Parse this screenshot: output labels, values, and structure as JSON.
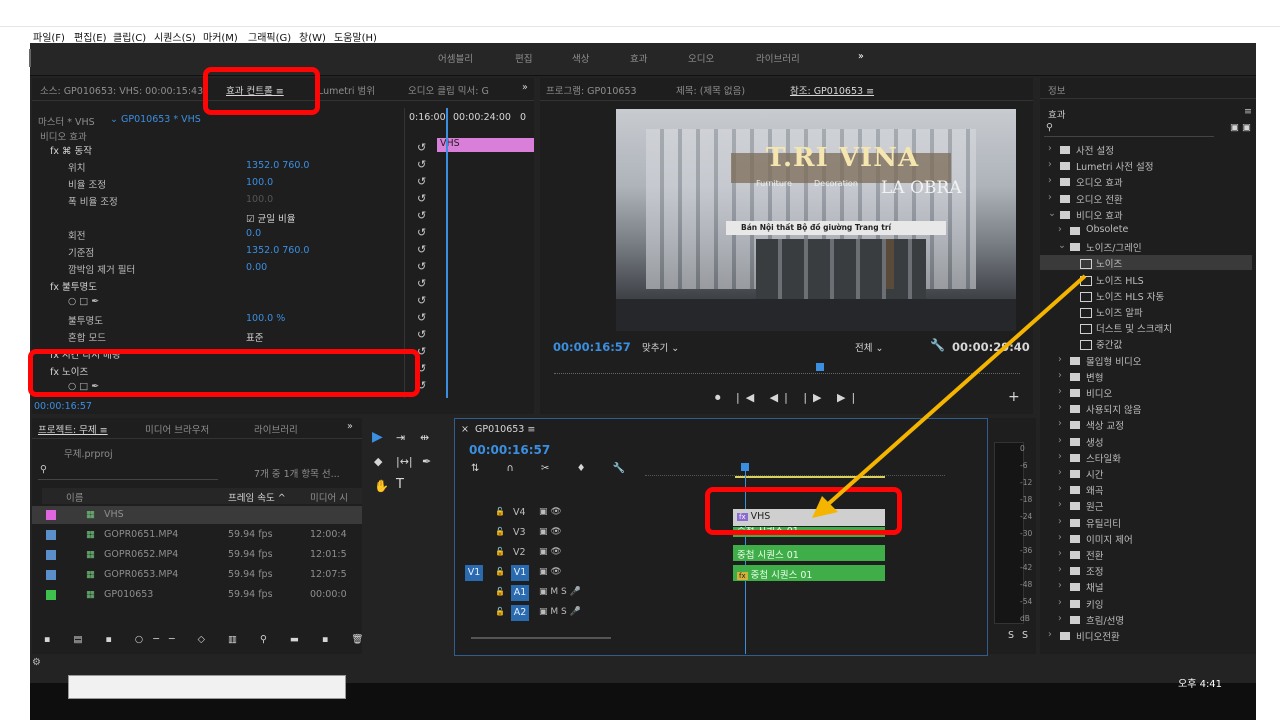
{
  "menubar": [
    "파일(F)",
    "편집(E)",
    "클립(C)",
    "시퀀스(S)",
    "마커(M)",
    "그래픽(G)",
    "창(W)",
    "도움말(H)"
  ],
  "workspaces": [
    "어셈블리",
    "편집",
    "색상",
    "효과",
    "오디오",
    "라이브러리",
    "»"
  ],
  "source_panel": {
    "tabs": [
      "소스: GP010653: VHS: 00:00:15:43",
      "효과 컨트롤 ≡",
      "Lumetri 범위",
      "오디오 클립 믹서: G",
      "»"
    ],
    "master": "마스터 * VHS",
    "clip": "GP010653 * VHS",
    "ruler_times": [
      "0:16:00",
      "00:00:24:00",
      "0"
    ],
    "vhs_label": "VHS",
    "section": "비디오 효과",
    "rows": [
      {
        "label": "fx ⌘ 동작",
        "indent": 0
      },
      {
        "label": "위치",
        "value": "1352.0   760.0",
        "indent": 1
      },
      {
        "label": "비율 조정",
        "value": "100.0",
        "indent": 1
      },
      {
        "label": "폭 비율 조정",
        "value": "100.0",
        "indent": 1
      },
      {
        "label": "",
        "value": "☑ 균일 비율",
        "indent": 1
      },
      {
        "label": "회전",
        "value": "0.0",
        "indent": 1
      },
      {
        "label": "기준점",
        "value": "1352.0   760.0",
        "indent": 1
      },
      {
        "label": "깜박임 제거 필터",
        "value": "0.00",
        "indent": 1
      },
      {
        "label": "fx 불투명도",
        "indent": 0
      },
      {
        "label": "○ □ ✒",
        "indent": 1
      },
      {
        "label": "불투명도",
        "value": "100.0 %",
        "indent": 1
      },
      {
        "label": "혼합 모드",
        "value": "표준",
        "indent": 1
      },
      {
        "label": "fx 시간 다시 매핑",
        "indent": 0
      },
      {
        "label": "fx 노이즈",
        "indent": 0
      },
      {
        "label": "○ □ ✒",
        "indent": 1
      }
    ],
    "timecode": "00:00:16:57"
  },
  "program": {
    "tabs": [
      "프로그램: GP010653",
      "제목: (제목 없음)",
      "참조: GP010653 ≡"
    ],
    "timecode": "00:00:16:57",
    "fit": "맞추기",
    "full": "전체",
    "end_time": "00:00:29:40",
    "signage": [
      "T.RI VINA",
      "LA OBRA",
      "Furniture",
      "Decoration",
      "Bán Nội thất  Bộ đồ giường  Trang trí"
    ]
  },
  "project": {
    "tabs": [
      "프로젝트: 무제 ≡",
      "미디어 브라우저",
      "라이브러리",
      "»"
    ],
    "file": "무제.prproj",
    "count": "7개 중 1개 항목 선...",
    "headers": [
      "이름",
      "프레임 속도 ^",
      "미디어 시"
    ],
    "items": [
      {
        "name": "VHS",
        "fps": "",
        "time": "",
        "color": "#e066e0"
      },
      {
        "name": "GOPR0651.MP4",
        "fps": "59.94 fps",
        "time": "12:00:4",
        "color": "#5b8fc9"
      },
      {
        "name": "GOPR0652.MP4",
        "fps": "59.94 fps",
        "time": "12:01:5",
        "color": "#5b8fc9"
      },
      {
        "name": "GOPR0653.MP4",
        "fps": "59.94 fps",
        "time": "12:07:5",
        "color": "#5b8fc9"
      },
      {
        "name": "GP010653",
        "fps": "59.94 fps",
        "time": "00:00:0",
        "color": "#3fbf4f"
      }
    ]
  },
  "timeline": {
    "tab": "GP010653 ≡",
    "timecode": "00:00:16:57",
    "video_tracks": [
      "V4",
      "V3",
      "V2",
      "V1"
    ],
    "audio_tracks": [
      "A1",
      "A2"
    ],
    "v1_source": "V1",
    "clips": {
      "v4": "VHS",
      "v3": "중첩 시퀀스 01",
      "v2": "중첩 시퀀스 01",
      "v1": "중첩 시퀀스 01"
    }
  },
  "meter": {
    "scale": [
      "0",
      "-6",
      "-12",
      "-18",
      "-24",
      "-30",
      "-36",
      "-42",
      "-48",
      "-54",
      "dB"
    ],
    "solo": [
      "S",
      "S"
    ]
  },
  "effects": {
    "info": "정보",
    "title": "효과",
    "tree": [
      {
        "label": "사전 설정",
        "level": 0,
        "type": "folder"
      },
      {
        "label": "Lumetri 사전 설정",
        "level": 0,
        "type": "folder"
      },
      {
        "label": "오디오 효과",
        "level": 0,
        "type": "folder"
      },
      {
        "label": "오디오 전환",
        "level": 0,
        "type": "folder"
      },
      {
        "label": "비디오 효과",
        "level": 0,
        "type": "folder"
      },
      {
        "label": "Obsolete",
        "level": 1,
        "type": "folder"
      },
      {
        "label": "노이즈/그레인",
        "level": 1,
        "type": "folder"
      },
      {
        "label": "노이즈",
        "level": 2,
        "type": "effect",
        "selected": true
      },
      {
        "label": "노이즈 HLS",
        "level": 2,
        "type": "effect"
      },
      {
        "label": "노이즈 HLS 자동",
        "level": 2,
        "type": "effect"
      },
      {
        "label": "노이즈 알파",
        "level": 2,
        "type": "effect"
      },
      {
        "label": "더스트 및 스크래치",
        "level": 2,
        "type": "effect"
      },
      {
        "label": "중간값",
        "level": 2,
        "type": "effect"
      },
      {
        "label": "몰입형 비디오",
        "level": 1,
        "type": "folder"
      },
      {
        "label": "변형",
        "level": 1,
        "type": "folder"
      },
      {
        "label": "비디오",
        "level": 1,
        "type": "folder"
      },
      {
        "label": "사용되지 않음",
        "level": 1,
        "type": "folder"
      },
      {
        "label": "색상 교정",
        "level": 1,
        "type": "folder"
      },
      {
        "label": "생성",
        "level": 1,
        "type": "folder"
      },
      {
        "label": "스타일화",
        "level": 1,
        "type": "folder"
      },
      {
        "label": "시간",
        "level": 1,
        "type": "folder"
      },
      {
        "label": "왜곡",
        "level": 1,
        "type": "folder"
      },
      {
        "label": "원근",
        "level": 1,
        "type": "folder"
      },
      {
        "label": "유틸리티",
        "level": 1,
        "type": "folder"
      },
      {
        "label": "이미지 제어",
        "level": 1,
        "type": "folder"
      },
      {
        "label": "전환",
        "level": 1,
        "type": "folder"
      },
      {
        "label": "조정",
        "level": 1,
        "type": "folder"
      },
      {
        "label": "채널",
        "level": 1,
        "type": "folder"
      },
      {
        "label": "키잉",
        "level": 1,
        "type": "folder"
      },
      {
        "label": "흐림/선명",
        "level": 1,
        "type": "folder"
      },
      {
        "label": "비디오전환",
        "level": 0,
        "type": "folder"
      }
    ]
  },
  "taskbar_time": "오후 4:41"
}
